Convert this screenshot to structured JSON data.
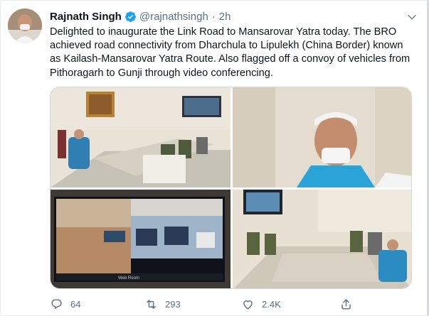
{
  "tweet": {
    "name": "Rajnath Singh",
    "handle": "@rajnathsingh",
    "separator": "·",
    "time": "2h",
    "text": "Delighted to inaugurate the Link Road  to Mansarovar Yatra today. The BRO achieved road connectivity from Dharchula to Lipulekh (China Border) known as Kailash-Mansarovar Yatra Route.  Also flagged off a convoy of vehicles from Pithoragarh to Gunji through video conferencing.",
    "photo_caption": "Web Room"
  },
  "actions": {
    "replies": "64",
    "retweets": "293",
    "likes": "2.4K"
  },
  "colors": {
    "text": "#0f1419",
    "secondary": "#5b7083",
    "verified": "#1da1f2",
    "border": "#cfd9de"
  },
  "icons": [
    "verified-badge-icon",
    "chevron-down-icon",
    "reply-icon",
    "retweet-icon",
    "like-icon",
    "share-icon"
  ]
}
